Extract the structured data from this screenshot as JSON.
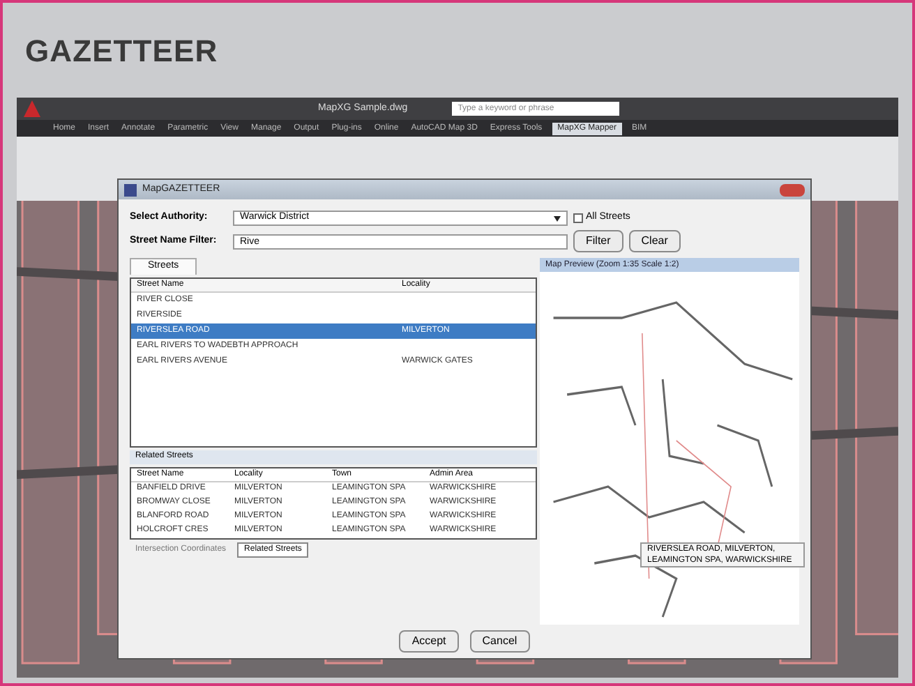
{
  "page_heading": "GAZETTEER",
  "app": {
    "title": "MapXG Sample.dwg",
    "search": {
      "placeholder": "Type a keyword or phrase"
    },
    "ribbon_tabs": [
      {
        "label": "Home",
        "selected": false
      },
      {
        "label": "Insert",
        "selected": false
      },
      {
        "label": "Annotate",
        "selected": false
      },
      {
        "label": "Parametric",
        "selected": false
      },
      {
        "label": "View",
        "selected": false
      },
      {
        "label": "Manage",
        "selected": false
      },
      {
        "label": "Output",
        "selected": false
      },
      {
        "label": "Plug-ins",
        "selected": false
      },
      {
        "label": "Online",
        "selected": false
      },
      {
        "label": "AutoCAD Map 3D",
        "selected": false
      },
      {
        "label": "Express Tools",
        "selected": false
      },
      {
        "label": "MapXG Mapper",
        "selected": true
      },
      {
        "label": "BIM",
        "selected": false
      }
    ]
  },
  "dialog": {
    "title": "MapGAZETTEER",
    "authority": {
      "label": "Select Authority:",
      "value": "Warwick District",
      "option": "All Streets",
      "checked": false
    },
    "filter": {
      "label": "Street Name Filter:",
      "value": "Rive"
    },
    "filter_buttons": [
      "Filter",
      "Clear"
    ],
    "streets": {
      "tab": "Streets",
      "columns": [
        "Street Name",
        "Locality"
      ],
      "rows": [
        {
          "cells": [
            "RIVER CLOSE",
            ""
          ],
          "selected": false
        },
        {
          "cells": [
            "RIVERSIDE",
            ""
          ],
          "selected": false
        },
        {
          "cells": [
            "RIVERSLEA ROAD",
            "MILVERTON"
          ],
          "selected": true
        },
        {
          "cells": [
            "EARL RIVERS TO WADEBTH APPROACH",
            ""
          ],
          "selected": false
        },
        {
          "cells": [
            "EARL RIVERS AVENUE",
            "WARWICK GATES"
          ],
          "selected": false
        }
      ]
    },
    "map_preview": {
      "title": "Map Preview (Zoom 1:35 Scale 1:2)",
      "tooltip": "RIVERSLEA ROAD, MILVERTON, LEAMINGTON SPA, WARWICKSHIRE"
    },
    "related": {
      "title": "Related Streets",
      "columns": [
        "Street Name",
        "Locality",
        "Town",
        "Admin Area"
      ],
      "rows": [
        [
          "BANFIELD DRIVE",
          "MILVERTON",
          "LEAMINGTON SPA",
          "WARWICKSHIRE"
        ],
        [
          "BROMWAY CLOSE",
          "MILVERTON",
          "LEAMINGTON SPA",
          "WARWICKSHIRE"
        ],
        [
          "BLANFORD ROAD",
          "MILVERTON",
          "LEAMINGTON SPA",
          "WARWICKSHIRE"
        ],
        [
          "HOLCROFT CRES",
          "MILVERTON",
          "LEAMINGTON SPA",
          "WARWICKSHIRE"
        ]
      ]
    },
    "bottom_tabs": [
      {
        "label": "Intersection Coordinates",
        "selected": false
      },
      {
        "label": "Related Streets",
        "selected": true
      }
    ],
    "actions": [
      "Accept",
      "Cancel"
    ]
  }
}
